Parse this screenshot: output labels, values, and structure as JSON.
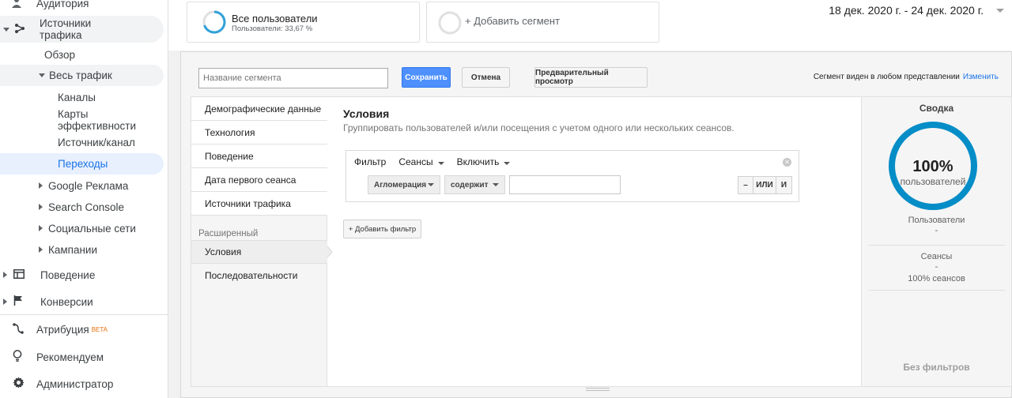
{
  "sidebar": {
    "audience": "Аудитория",
    "traffic_sources": "Источники трафика",
    "overview": "Обзор",
    "all_traffic": "Весь трафик",
    "channels": "Каналы",
    "treemaps": "Карты эффективности",
    "source_medium": "Источник/канал",
    "referrals": "Переходы",
    "google_ads": "Google Реклама",
    "search_console": "Search Console",
    "social": "Социальные сети",
    "campaigns": "Кампании",
    "behavior": "Поведение",
    "conversions": "Конверсии",
    "attribution": "Атрибуция",
    "attribution_badge": "BETA",
    "discover": "Рекомендуем",
    "admin": "Администратор"
  },
  "segments": {
    "all_users_title": "Все пользователи",
    "all_users_sub": "Пользователи: 33,67 %",
    "add_segment": "+ Добавить сегмент"
  },
  "date_range": "18 дек. 2020 г. - 24 дек. 2020 г.",
  "toolbar": {
    "name_placeholder": "Название сегмента",
    "save": "Сохранить",
    "cancel": "Отмена",
    "preview": "Предварительный просмотр",
    "visibility_text": "Сегмент виден в любом представлении",
    "change_link": "Изменить"
  },
  "categories": {
    "demographics": "Демографические данные",
    "technology": "Технология",
    "behavior": "Поведение",
    "first_session": "Дата первого сеанса",
    "traffic_sources": "Источники трафика",
    "advanced_header": "Расширенный",
    "conditions": "Условия",
    "sequences": "Последовательности"
  },
  "conditions": {
    "title": "Условия",
    "subtitle": "Группировать пользователей и/или посещения с учетом одного или нескольких сеансов.",
    "filter_label": "Фильтр",
    "scope": "Сеансы",
    "include": "Включить",
    "dimension": "Агломерация",
    "operator": "содержит",
    "value": "",
    "minus": "–",
    "or": "ИЛИ",
    "and": "И",
    "add_filter": "+ Добавить фильтр"
  },
  "summary": {
    "title": "Сводка",
    "percent": "100%",
    "percent_label": "пользователей",
    "users_label": "Пользователи",
    "users_value": "-",
    "sessions_label": "Сеансы",
    "sessions_value": "-",
    "sessions_pct": "100% сеансов",
    "no_filters": "Без фильтров"
  },
  "colors": {
    "accent": "#1a73e8",
    "ring": "#058dc7",
    "save_button": "#4d90fe",
    "segment_ring": "#30a1d9"
  }
}
